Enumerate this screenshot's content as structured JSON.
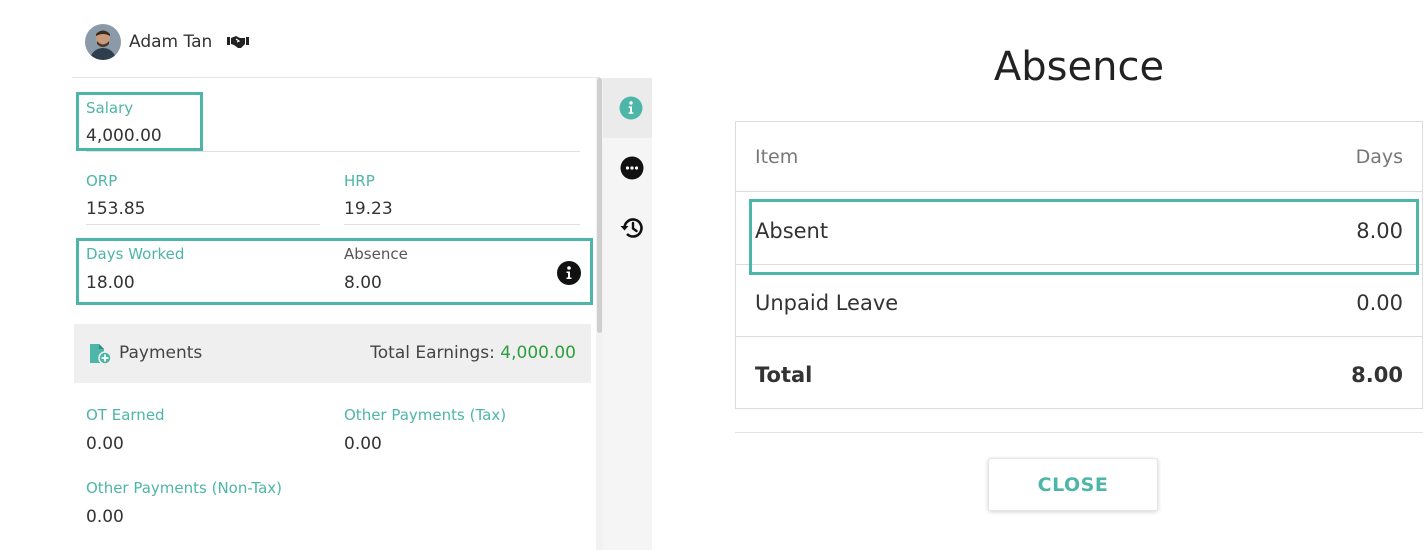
{
  "user": {
    "name": "Adam Tan",
    "avatar_icon": "person-avatar",
    "badge_icon": "handshake-icon"
  },
  "pay_fields": {
    "salary": {
      "label": "Salary",
      "value": "4,000.00"
    },
    "orp": {
      "label": "ORP",
      "value": "153.85"
    },
    "hrp": {
      "label": "HRP",
      "value": "19.23"
    },
    "days_worked": {
      "label": "Days Worked",
      "value": "18.00"
    },
    "absence": {
      "label": "Absence",
      "value": "8.00"
    }
  },
  "payments": {
    "label": "Payments",
    "total_label": "Total Earnings: ",
    "total_value": "4,000.00",
    "fields": {
      "ot_earned": {
        "label": "OT Earned",
        "value": "0.00"
      },
      "other_tax": {
        "label": "Other Payments (Tax)",
        "value": "0.00"
      },
      "other_non_tax": {
        "label": "Other Payments (Non-Tax)",
        "value": "0.00"
      }
    }
  },
  "side_rail": {
    "icons": [
      "info-icon",
      "more-icon",
      "history-icon"
    ]
  },
  "absence_dialog": {
    "title": "Absence",
    "columns": {
      "item": "Item",
      "days": "Days"
    },
    "rows": [
      {
        "item": "Absent",
        "days": "8.00"
      },
      {
        "item": "Unpaid Leave",
        "days": "0.00"
      }
    ],
    "total": {
      "item": "Total",
      "days": "8.00"
    },
    "close_label": "CLOSE"
  },
  "colors": {
    "accent": "#4db6a8",
    "earnings_green": "#2e9e3e",
    "highlight_border": "#4db6a8"
  }
}
